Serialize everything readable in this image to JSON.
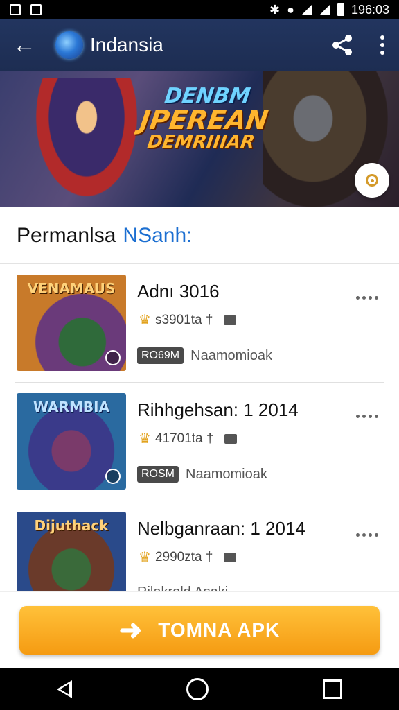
{
  "status_bar": {
    "time": "196:03"
  },
  "app_bar": {
    "title": "Indansia"
  },
  "banner": {
    "line1": "DENBM",
    "line2": "JPEREAN",
    "line3": "DEMRIIIAR"
  },
  "section": {
    "title_main": "Permanlsa",
    "title_accent": "NSanh:"
  },
  "items": [
    {
      "thumb_label": "VENAMAUS",
      "title": "Adnı 3016",
      "meta": "s3901ta †",
      "badge": "RO69M",
      "badge_text": "Naamomioak"
    },
    {
      "thumb_label": "WARMBIA",
      "title": "Rihhgehsan: 1 2014",
      "meta": "41701ta †",
      "badge": "ROSM",
      "badge_text": "Naamomioak"
    },
    {
      "thumb_label": "Dijuthack",
      "title": "Nelbganraan: 1 2014",
      "meta": "2990zta †",
      "sub_text": "Rilakrold Asaki"
    }
  ],
  "cta": {
    "label": "TOMNA APK"
  },
  "colors": {
    "app_bar": "#1f2f56",
    "accent": "#1c6fd1",
    "cta": "#f7a51c",
    "star": "#e2a21d"
  }
}
